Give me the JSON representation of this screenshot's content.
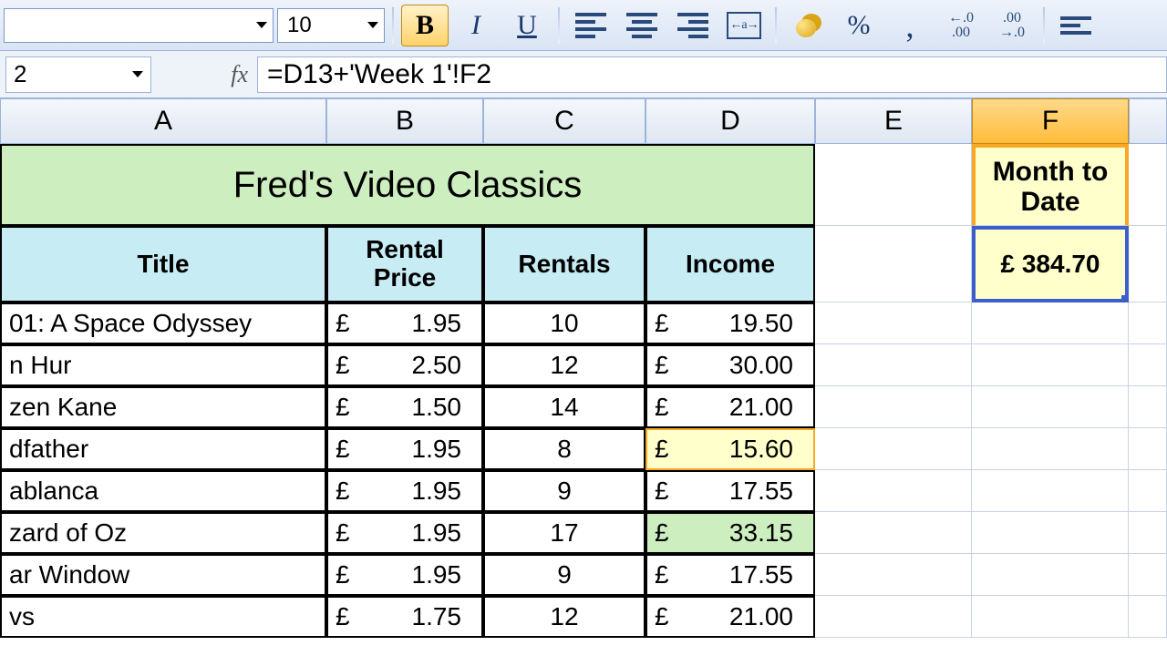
{
  "toolbar": {
    "font_name": "",
    "font_size": "10",
    "bold": "B",
    "italic": "I",
    "underline": "U",
    "percent": "%",
    "comma": ",",
    "inc_dec_a": ".0",
    "inc_dec_b": ".00"
  },
  "formula_bar": {
    "cell_ref": "2",
    "fx": "fx",
    "formula": "=D13+'Week 1'!F2"
  },
  "columns": [
    "A",
    "B",
    "C",
    "D",
    "E",
    "F",
    ""
  ],
  "sheet": {
    "title_merged": "Fred's Video Classics",
    "headers": {
      "a": "Title",
      "b": "Rental Price",
      "c": "Rentals",
      "d": "Income"
    },
    "mtd": {
      "label": "Month to Date",
      "value": "£ 384.70"
    }
  },
  "rows": [
    {
      "title": "01: A Space Odyssey",
      "price": "1.95",
      "rentals": "10",
      "income": "19.50",
      "hl": ""
    },
    {
      "title": "n Hur",
      "price": "2.50",
      "rentals": "12",
      "income": "30.00",
      "hl": ""
    },
    {
      "title": "zen Kane",
      "price": "1.50",
      "rentals": "14",
      "income": "21.00",
      "hl": ""
    },
    {
      "title": "dfather",
      "price": "1.95",
      "rentals": "8",
      "income": "15.60",
      "hl": "yellow"
    },
    {
      "title": "ablanca",
      "price": "1.95",
      "rentals": "9",
      "income": "17.55",
      "hl": ""
    },
    {
      "title": "zard of Oz",
      "price": "1.95",
      "rentals": "17",
      "income": "33.15",
      "hl": "green"
    },
    {
      "title": "ar Window",
      "price": "1.95",
      "rentals": "9",
      "income": "17.55",
      "hl": ""
    },
    {
      "title": "vs",
      "price": "1.75",
      "rentals": "12",
      "income": "21.00",
      "hl": ""
    }
  ],
  "currency": "£"
}
